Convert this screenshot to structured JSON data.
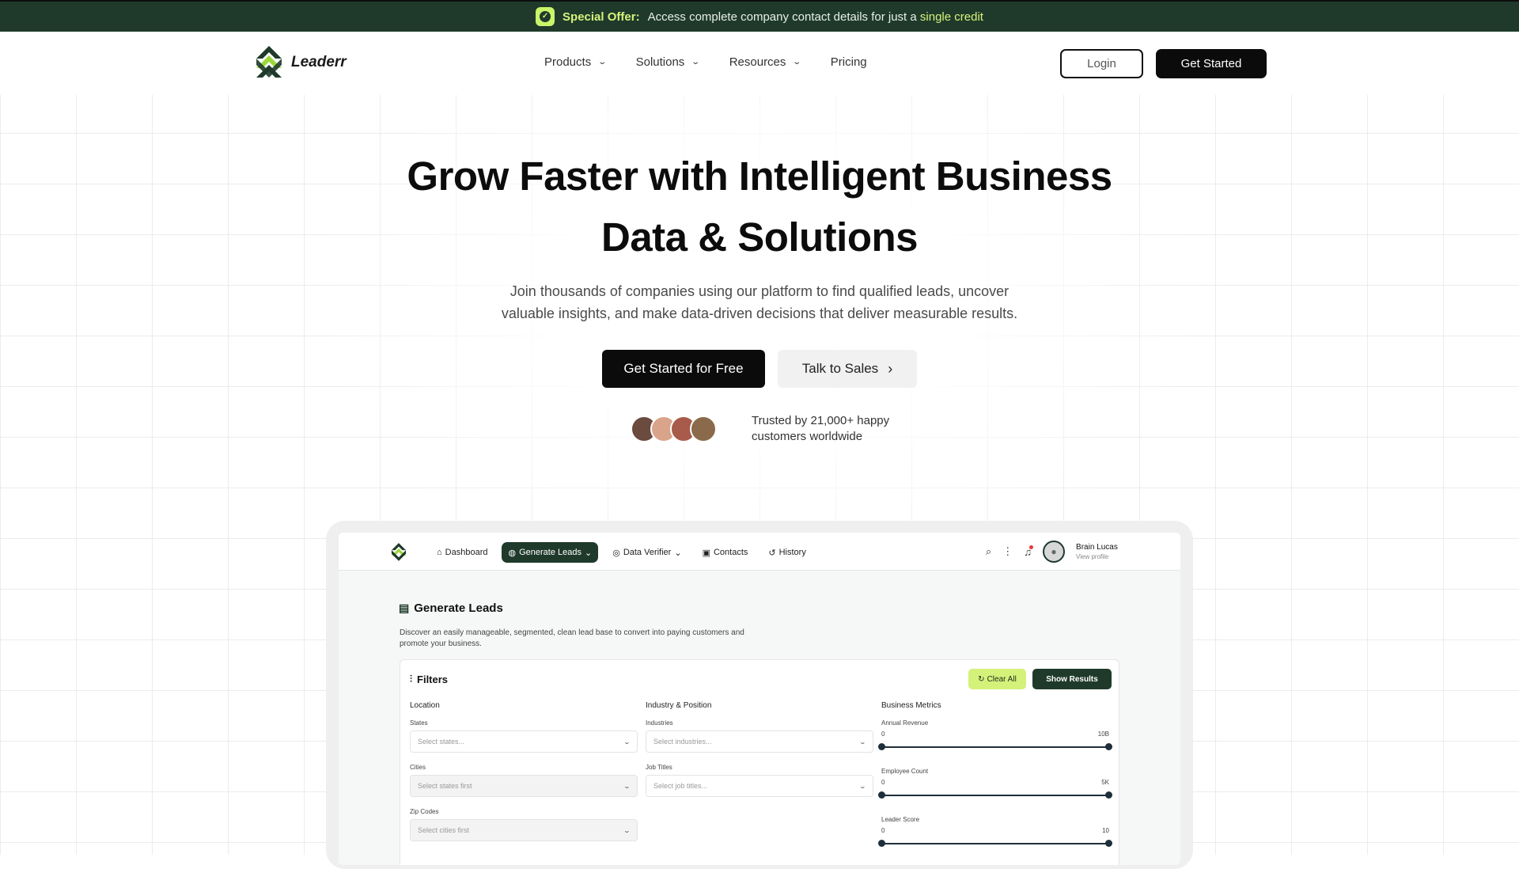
{
  "promo": {
    "label": "Special Offer:",
    "text": "Access complete company contact details for just a",
    "highlight": "single credit"
  },
  "nav": {
    "brand": "Leaderr",
    "menu": [
      "Products",
      "Solutions",
      "Resources",
      "Pricing"
    ],
    "login": "Login",
    "get_started": "Get Started"
  },
  "hero": {
    "title_line1": "Grow Faster with Intelligent Business",
    "title_line2": "Data & Solutions",
    "subtitle_line1": "Join thousands of companies using our platform to find qualified leads, uncover",
    "subtitle_line2": "valuable insights, and make data-driven decisions that deliver measurable results.",
    "cta_primary": "Get Started for Free",
    "cta_secondary": "Talk to Sales",
    "trust_line1": "Trusted by 21,000+ happy",
    "trust_line2": "customers worldwide"
  },
  "app": {
    "menu": {
      "dashboard": "Dashboard",
      "generate_leads": "Generate Leads",
      "data_verifier": "Data Verifier",
      "contacts": "Contacts",
      "history": "History"
    },
    "user": {
      "name": "Brain Lucas",
      "sub": "View profile"
    },
    "page_title": "Generate Leads",
    "description_line1": "Discover an easily manageable, segmented, clean lead base to convert into paying customers and",
    "description_line2": "promote your business.",
    "filters": {
      "title": "Filters",
      "clear": "Clear All",
      "show": "Show Results",
      "location": {
        "title": "Location",
        "states_label": "States",
        "states_placeholder": "Select states...",
        "cities_label": "Cities",
        "cities_placeholder": "Select states first",
        "zip_label": "Zip Codes",
        "zip_placeholder": "Select cities first"
      },
      "industry": {
        "title": "Industry & Position",
        "industries_label": "Industries",
        "industries_placeholder": "Select industries...",
        "jobs_label": "Job Titles",
        "jobs_placeholder": "Select job titles..."
      },
      "metrics": {
        "title": "Business Metrics",
        "revenue": {
          "label": "Annual Revenue",
          "min": "0",
          "max": "10B"
        },
        "employees": {
          "label": "Employee Count",
          "min": "0",
          "max": "5K"
        },
        "score": {
          "label": "Leader Score",
          "min": "0",
          "max": "10"
        }
      }
    }
  },
  "colors": {
    "brand_dark": "#1f3a2b",
    "brand_lime": "#c9f56a",
    "button_black": "#0b0b0b"
  }
}
